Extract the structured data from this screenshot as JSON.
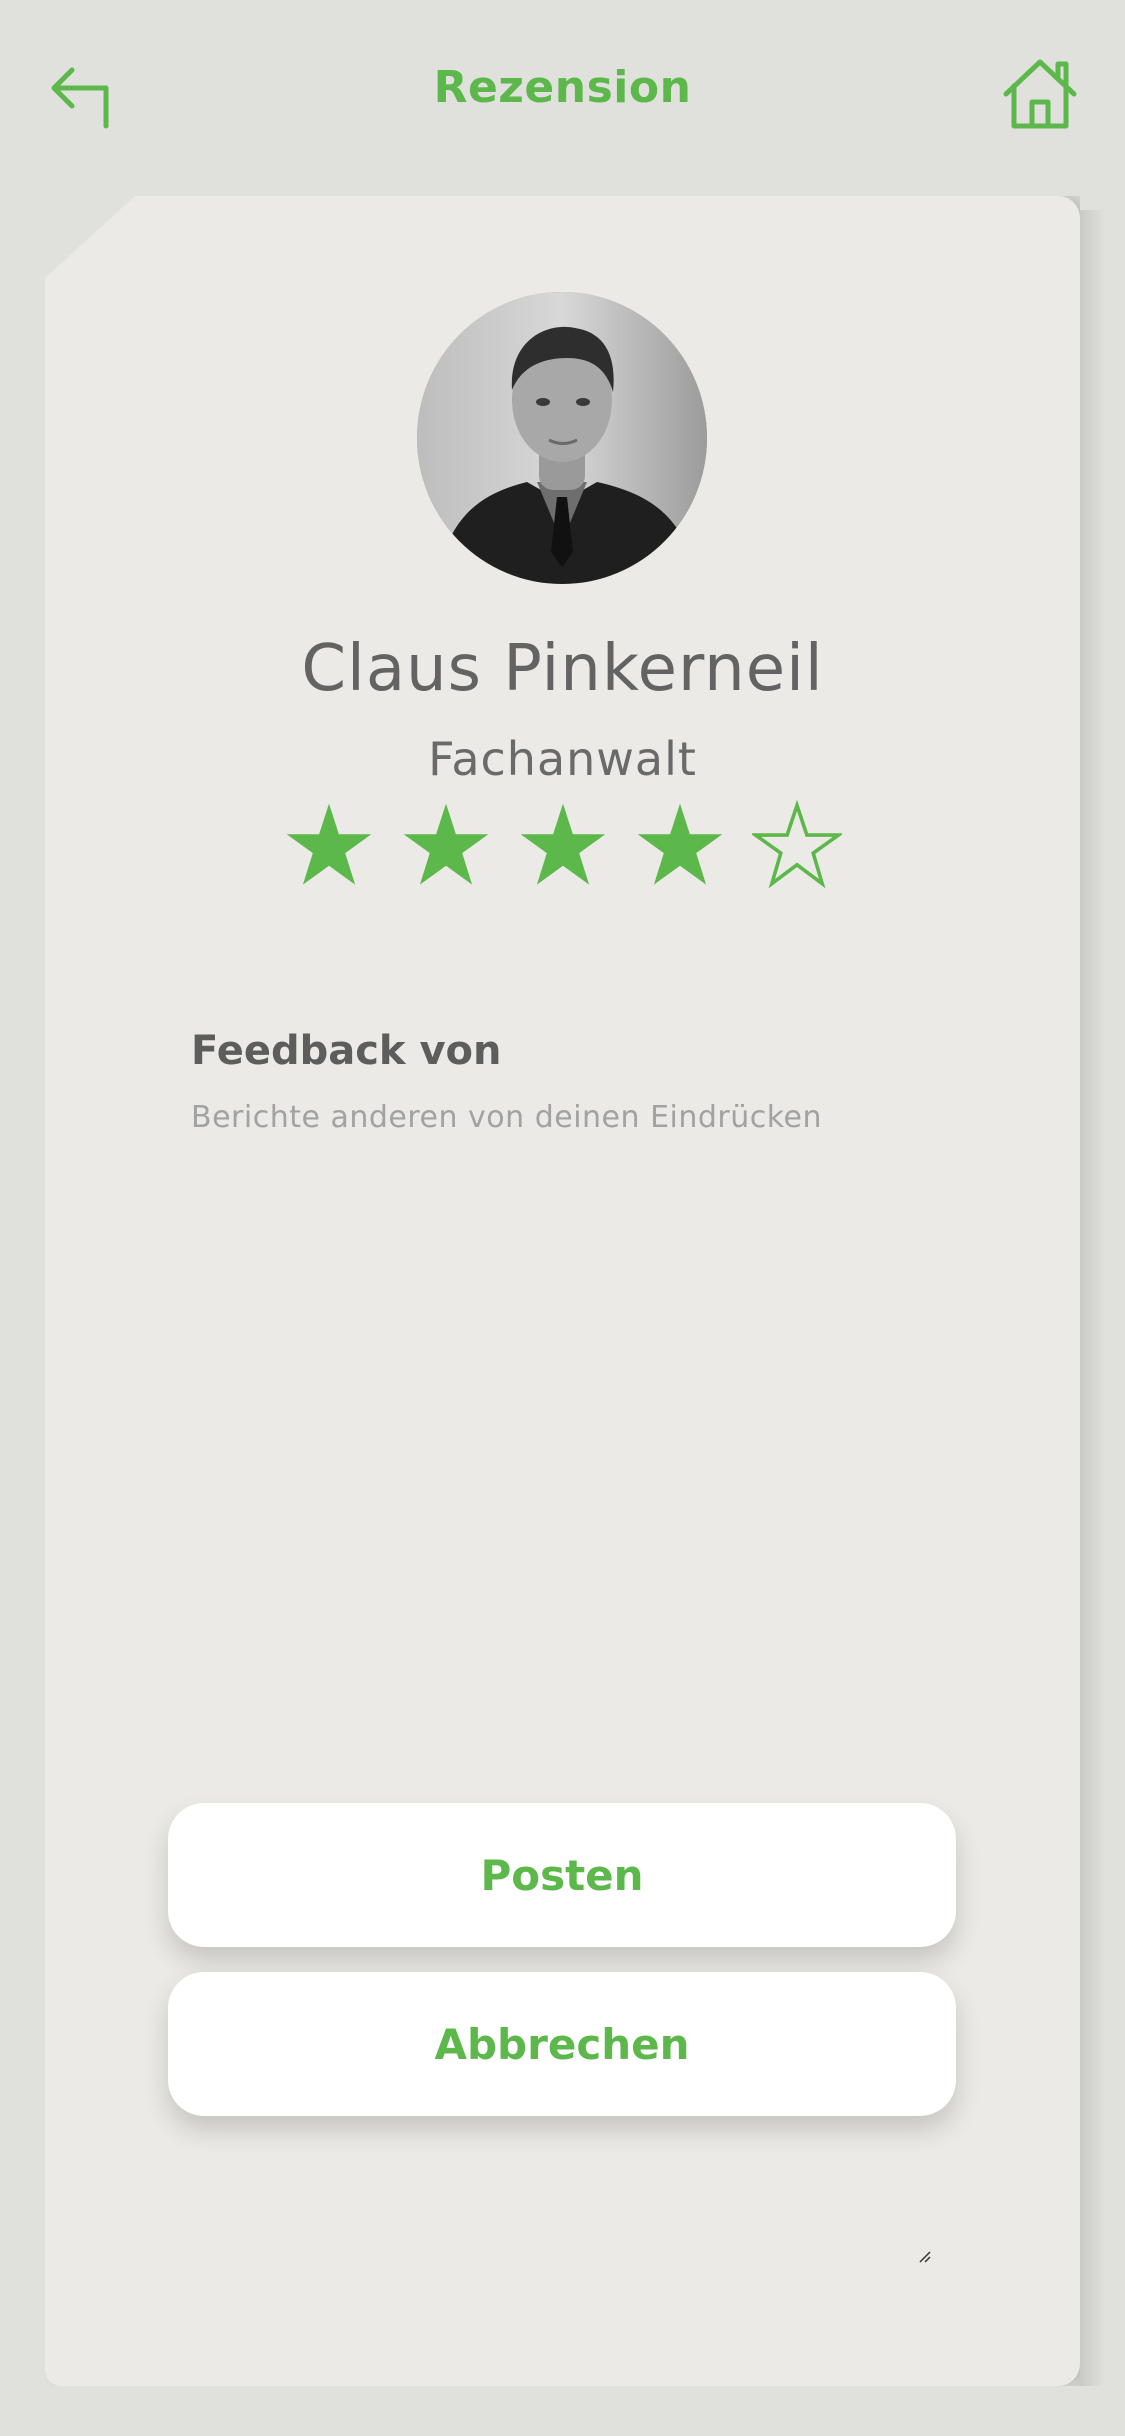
{
  "header": {
    "title": "Rezension",
    "back_icon": "back-arrow-icon",
    "home_icon": "home-icon"
  },
  "profile": {
    "name": "Claus Pinkerneil",
    "role": "Fachanwalt",
    "rating": 4,
    "rating_max": 5
  },
  "feedback": {
    "title": "Feedback von",
    "placeholder": "Berichte anderen von deinen Eindrücken"
  },
  "actions": {
    "post_label": "Posten",
    "cancel_label": "Abbrechen"
  },
  "colors": {
    "accent": "#5cb84a",
    "background": "#e0e0dc",
    "card": "#ebeae6"
  }
}
